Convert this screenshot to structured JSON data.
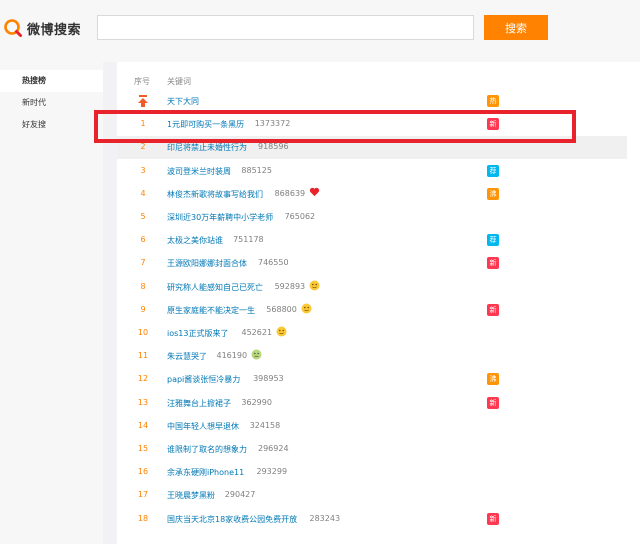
{
  "header": {
    "logo_text": "微博搜索",
    "search_placeholder": "",
    "search_button": "搜索"
  },
  "sidebar": {
    "items": [
      {
        "label": "热搜榜",
        "active": true
      },
      {
        "label": "新时代",
        "active": false
      },
      {
        "label": "好友搜",
        "active": false
      }
    ]
  },
  "table": {
    "col_rank": "序号",
    "col_keyword": "关键词",
    "rows": [
      {
        "rank": "",
        "pinned": true,
        "keyword": "天下大同",
        "count": "",
        "emoji": "",
        "badge": "热",
        "badge_type": "hot"
      },
      {
        "rank": "1",
        "keyword": "1元即可购买一条黑历",
        "count": "1373372",
        "emoji": "",
        "badge": "新",
        "badge_type": "new"
      },
      {
        "rank": "2",
        "keyword": "印尼将禁止未婚性行为",
        "count": "918596",
        "emoji": "",
        "badge": "",
        "badge_type": ""
      },
      {
        "rank": "3",
        "keyword": "波司登米兰时装周",
        "count": "885125",
        "emoji": "",
        "badge": "荐",
        "badge_type": "rec"
      },
      {
        "rank": "4",
        "keyword": "林俊杰新歌将故事写给我们",
        "count": "868639",
        "emoji": "heart",
        "badge": "沸",
        "badge_type": "hot"
      },
      {
        "rank": "5",
        "keyword": "深圳近30万年薪聘中小学老师",
        "count": "765062",
        "emoji": "",
        "badge": "",
        "badge_type": ""
      },
      {
        "rank": "6",
        "keyword": "太极之美你站谁",
        "count": "751178",
        "emoji": "",
        "badge": "荐",
        "badge_type": "rec"
      },
      {
        "rank": "7",
        "keyword": "王源欧阳娜娜封面合体",
        "count": "746550",
        "emoji": "",
        "badge": "新",
        "badge_type": "new"
      },
      {
        "rank": "8",
        "keyword": "研究称人能感知自己已死亡",
        "count": "592893",
        "emoji": "face",
        "badge": "",
        "badge_type": ""
      },
      {
        "rank": "9",
        "keyword": "原生家庭能不能决定一生",
        "count": "568800",
        "emoji": "face",
        "badge": "新",
        "badge_type": "new"
      },
      {
        "rank": "10",
        "keyword": "ios13正式版来了",
        "count": "452621",
        "emoji": "face",
        "badge": "",
        "badge_type": ""
      },
      {
        "rank": "11",
        "keyword": "朱云慧哭了",
        "count": "416190",
        "emoji": "face-green",
        "badge": "",
        "badge_type": ""
      },
      {
        "rank": "12",
        "keyword": "papi酱谈张恒冷暴力",
        "count": "398953",
        "emoji": "",
        "badge": "沸",
        "badge_type": "hot"
      },
      {
        "rank": "13",
        "keyword": "汪雅舞台上掀裙子",
        "count": "362990",
        "emoji": "",
        "badge": "新",
        "badge_type": "new"
      },
      {
        "rank": "14",
        "keyword": "中国年轻人想早退休",
        "count": "324158",
        "emoji": "",
        "badge": "",
        "badge_type": ""
      },
      {
        "rank": "15",
        "keyword": "谁限制了取名的想象力",
        "count": "296924",
        "emoji": "",
        "badge": "",
        "badge_type": ""
      },
      {
        "rank": "16",
        "keyword": "余承东硬刚iPhone11",
        "count": "293299",
        "emoji": "",
        "badge": "",
        "badge_type": ""
      },
      {
        "rank": "17",
        "keyword": "王晓晨梦黑粉",
        "count": "290427",
        "emoji": "",
        "badge": "",
        "badge_type": ""
      },
      {
        "rank": "18",
        "keyword": "国庆当天北京18家收费公园免费开放",
        "count": "283243",
        "emoji": "",
        "badge": "新",
        "badge_type": "new"
      }
    ]
  },
  "colors": {
    "accent": "#ff8200",
    "link": "#0078b6",
    "highlight_border": "#e8232b"
  }
}
